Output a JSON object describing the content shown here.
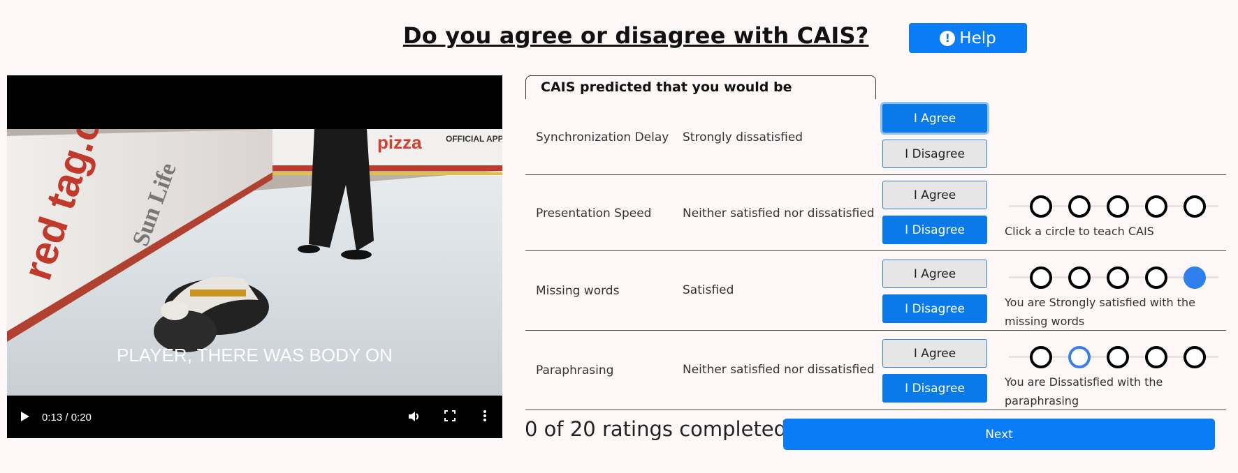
{
  "header": {
    "title": "Do you agree or disagree with CAIS?",
    "help_label": "Help"
  },
  "video": {
    "caption": "PLAYER, THERE WAS BODY ON",
    "time": "0:13 / 0:20",
    "progress": 0.63,
    "frame_signage": {
      "left": "red tag.ca",
      "middle": "Sun Life",
      "right": "OFFICIAL APP",
      "top": "pizza"
    }
  },
  "panel": {
    "heading": "CAIS predicted that you would be",
    "agree_label": "I Agree",
    "disagree_label": "I Disagree",
    "rows": [
      {
        "category": "Synchronization Delay",
        "prediction": "Strongly dissatisfied",
        "selected": "agree",
        "scale_message": ""
      },
      {
        "category": "Presentation Speed",
        "prediction": "Neither satisfied nor dissatisfied",
        "selected": "disagree",
        "scale_message": "Click a circle to teach CAIS"
      },
      {
        "category": "Missing words",
        "prediction": "Satisfied",
        "selected": "disagree",
        "scale_message": "You are Strongly satisfied with the missing words"
      },
      {
        "category": "Paraphrasing",
        "prediction": "Neither satisfied nor dissatisfied",
        "selected": "disagree",
        "scale_message": "You are Dissatisfied with the paraphrasing"
      }
    ]
  },
  "footer": {
    "progress_text": "0 of 20 ratings completed",
    "next_label": "Next"
  },
  "colors": {
    "accent": "#0a7cf6",
    "background": "#fdf8f7"
  }
}
